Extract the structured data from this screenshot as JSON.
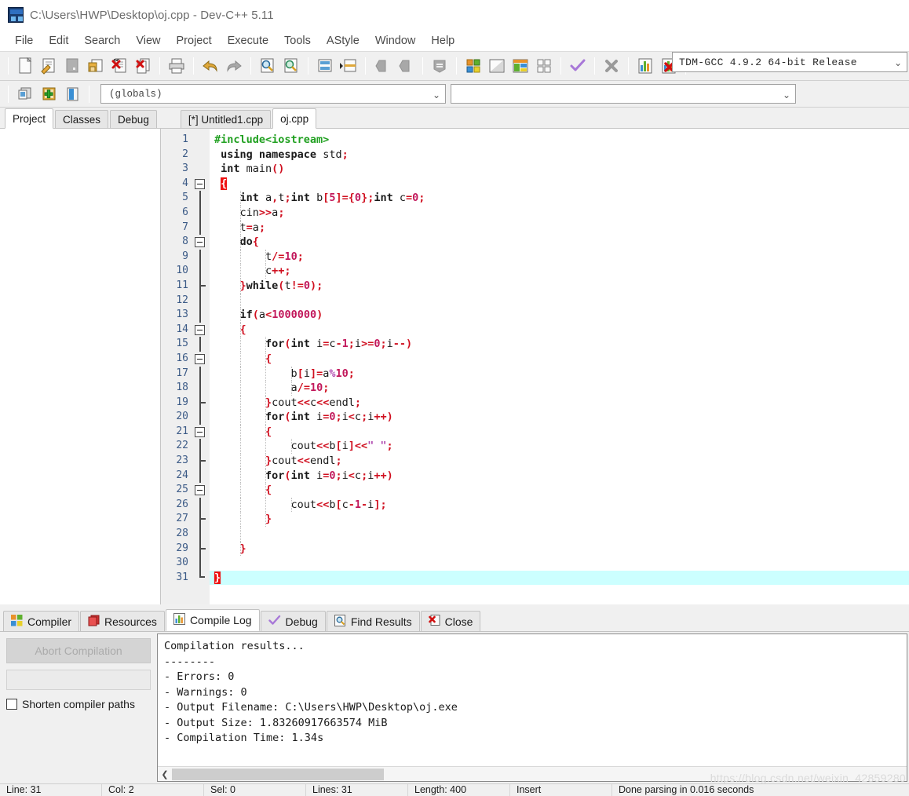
{
  "window": {
    "title": "C:\\Users\\HWP\\Desktop\\oj.cpp - Dev-C++ 5.11",
    "icon": "devcpp-icon"
  },
  "menubar": {
    "items": [
      {
        "label": "File"
      },
      {
        "label": "Edit"
      },
      {
        "label": "Search"
      },
      {
        "label": "View"
      },
      {
        "label": "Project"
      },
      {
        "label": "Execute"
      },
      {
        "label": "Tools"
      },
      {
        "label": "AStyle"
      },
      {
        "label": "Window"
      },
      {
        "label": "Help"
      }
    ]
  },
  "toolbar": {
    "compiler_set": "TDM-GCC 4.9.2 64-bit Release",
    "buttons": [
      {
        "name": "new-file-icon"
      },
      {
        "name": "open-file-icon"
      },
      {
        "name": "save-file-icon"
      },
      {
        "name": "save-all-icon"
      },
      {
        "name": "close-file-icon"
      },
      {
        "name": "close-all-icon"
      },
      {
        "name": "print-icon"
      },
      {
        "name": "undo-icon"
      },
      {
        "name": "redo-icon"
      },
      {
        "name": "find-icon"
      },
      {
        "name": "replace-icon"
      },
      {
        "name": "goto-line-icon"
      },
      {
        "name": "goto-function-icon"
      },
      {
        "name": "back-icon"
      },
      {
        "name": "forward-icon"
      },
      {
        "name": "toggle-bookmark-icon"
      },
      {
        "name": "compile-icon"
      },
      {
        "name": "run-icon"
      },
      {
        "name": "compile-and-run-icon"
      },
      {
        "name": "rebuild-all-icon"
      },
      {
        "name": "syntax-check-icon"
      },
      {
        "name": "stop-execution-icon"
      },
      {
        "name": "profile-icon"
      },
      {
        "name": "delete-profile-icon"
      }
    ],
    "row2_buttons": [
      {
        "name": "new-project-icon"
      },
      {
        "name": "add-to-project-icon"
      },
      {
        "name": "remove-from-project-icon"
      }
    ],
    "scope_combo": "(globals)",
    "member_combo": ""
  },
  "left_tabs": {
    "items": [
      {
        "label": "Project",
        "active": true
      },
      {
        "label": "Classes",
        "active": false
      },
      {
        "label": "Debug",
        "active": false
      }
    ]
  },
  "editor_tabs": {
    "items": [
      {
        "label": "[*] Untitled1.cpp",
        "active": false
      },
      {
        "label": "oj.cpp",
        "active": true
      }
    ]
  },
  "editor": {
    "highlighted_line": 31,
    "lines": [
      {
        "n": 1,
        "fold": "none",
        "indent_guides": 0,
        "tokens": [
          {
            "t": "pre",
            "v": "#include<iostream>"
          }
        ]
      },
      {
        "n": 2,
        "fold": "none",
        "indent_guides": 0,
        "tokens": [
          {
            "t": "sp",
            "v": " "
          },
          {
            "t": "kw",
            "v": "using namespace"
          },
          {
            "t": "id",
            "v": " std"
          },
          {
            "t": "op",
            "v": ";"
          }
        ]
      },
      {
        "n": 3,
        "fold": "none",
        "indent_guides": 0,
        "tokens": [
          {
            "t": "sp",
            "v": " "
          },
          {
            "t": "kw",
            "v": "int"
          },
          {
            "t": "id",
            "v": " main"
          },
          {
            "t": "op",
            "v": "()"
          }
        ]
      },
      {
        "n": 4,
        "fold": "start",
        "indent_guides": 0,
        "tokens": [
          {
            "t": "sp",
            "v": " "
          },
          {
            "t": "sel",
            "v": "{"
          }
        ]
      },
      {
        "n": 5,
        "fold": "bar",
        "indent_guides": 1,
        "tokens": [
          {
            "t": "sp",
            "v": "    "
          },
          {
            "t": "kw",
            "v": "int"
          },
          {
            "t": "id",
            "v": " a"
          },
          {
            "t": "op",
            "v": ","
          },
          {
            "t": "id",
            "v": "t"
          },
          {
            "t": "op",
            "v": ";"
          },
          {
            "t": "kw",
            "v": "int"
          },
          {
            "t": "id",
            "v": " b"
          },
          {
            "t": "op",
            "v": "["
          },
          {
            "t": "num",
            "v": "5"
          },
          {
            "t": "op",
            "v": "]={"
          },
          {
            "t": "num",
            "v": "0"
          },
          {
            "t": "op",
            "v": "};"
          },
          {
            "t": "kw",
            "v": "int"
          },
          {
            "t": "id",
            "v": " c"
          },
          {
            "t": "op",
            "v": "="
          },
          {
            "t": "num",
            "v": "0"
          },
          {
            "t": "op",
            "v": ";"
          }
        ]
      },
      {
        "n": 6,
        "fold": "bar",
        "indent_guides": 1,
        "tokens": [
          {
            "t": "sp",
            "v": "    "
          },
          {
            "t": "id",
            "v": "cin"
          },
          {
            "t": "op",
            "v": ">>"
          },
          {
            "t": "id",
            "v": "a"
          },
          {
            "t": "op",
            "v": ";"
          }
        ]
      },
      {
        "n": 7,
        "fold": "bar",
        "indent_guides": 1,
        "tokens": [
          {
            "t": "sp",
            "v": "    "
          },
          {
            "t": "id",
            "v": "t"
          },
          {
            "t": "op",
            "v": "="
          },
          {
            "t": "id",
            "v": "a"
          },
          {
            "t": "op",
            "v": ";"
          }
        ]
      },
      {
        "n": 8,
        "fold": "start",
        "indent_guides": 1,
        "tokens": [
          {
            "t": "sp",
            "v": "    "
          },
          {
            "t": "kw",
            "v": "do"
          },
          {
            "t": "op",
            "v": "{"
          }
        ]
      },
      {
        "n": 9,
        "fold": "bar",
        "indent_guides": 2,
        "tokens": [
          {
            "t": "sp",
            "v": "        "
          },
          {
            "t": "id",
            "v": "t"
          },
          {
            "t": "op",
            "v": "/="
          },
          {
            "t": "num",
            "v": "10"
          },
          {
            "t": "op",
            "v": ";"
          }
        ]
      },
      {
        "n": 10,
        "fold": "bar",
        "indent_guides": 2,
        "tokens": [
          {
            "t": "sp",
            "v": "        "
          },
          {
            "t": "id",
            "v": "c"
          },
          {
            "t": "op",
            "v": "++;"
          }
        ]
      },
      {
        "n": 11,
        "fold": "end",
        "indent_guides": 1,
        "tokens": [
          {
            "t": "sp",
            "v": "    "
          },
          {
            "t": "op",
            "v": "}"
          },
          {
            "t": "kw",
            "v": "while"
          },
          {
            "t": "op",
            "v": "("
          },
          {
            "t": "id",
            "v": "t"
          },
          {
            "t": "op",
            "v": "!="
          },
          {
            "t": "num",
            "v": "0"
          },
          {
            "t": "op",
            "v": ");"
          }
        ]
      },
      {
        "n": 12,
        "fold": "bar",
        "indent_guides": 1,
        "tokens": []
      },
      {
        "n": 13,
        "fold": "bar",
        "indent_guides": 1,
        "tokens": [
          {
            "t": "sp",
            "v": "    "
          },
          {
            "t": "kw",
            "v": "if"
          },
          {
            "t": "op",
            "v": "("
          },
          {
            "t": "id",
            "v": "a"
          },
          {
            "t": "op",
            "v": "<"
          },
          {
            "t": "num",
            "v": "1000000"
          },
          {
            "t": "op",
            "v": ")"
          }
        ]
      },
      {
        "n": 14,
        "fold": "start",
        "indent_guides": 1,
        "tokens": [
          {
            "t": "sp",
            "v": "    "
          },
          {
            "t": "op",
            "v": "{"
          }
        ]
      },
      {
        "n": 15,
        "fold": "bar",
        "indent_guides": 2,
        "tokens": [
          {
            "t": "sp",
            "v": "        "
          },
          {
            "t": "kw",
            "v": "for"
          },
          {
            "t": "op",
            "v": "("
          },
          {
            "t": "kw",
            "v": "int"
          },
          {
            "t": "id",
            "v": " i"
          },
          {
            "t": "op",
            "v": "="
          },
          {
            "t": "id",
            "v": "c"
          },
          {
            "t": "op",
            "v": "-"
          },
          {
            "t": "num",
            "v": "1"
          },
          {
            "t": "op",
            "v": ";"
          },
          {
            "t": "id",
            "v": "i"
          },
          {
            "t": "op",
            "v": ">="
          },
          {
            "t": "num",
            "v": "0"
          },
          {
            "t": "op",
            "v": ";"
          },
          {
            "t": "id",
            "v": "i"
          },
          {
            "t": "op",
            "v": "--)"
          }
        ]
      },
      {
        "n": 16,
        "fold": "start",
        "indent_guides": 2,
        "tokens": [
          {
            "t": "sp",
            "v": "        "
          },
          {
            "t": "op",
            "v": "{"
          }
        ]
      },
      {
        "n": 17,
        "fold": "bar",
        "indent_guides": 3,
        "tokens": [
          {
            "t": "sp",
            "v": "            "
          },
          {
            "t": "id",
            "v": "b"
          },
          {
            "t": "op",
            "v": "["
          },
          {
            "t": "id",
            "v": "i"
          },
          {
            "t": "op",
            "v": "]="
          },
          {
            "t": "id",
            "v": "a"
          },
          {
            "t": "str",
            "v": "%"
          },
          {
            "t": "num",
            "v": "10"
          },
          {
            "t": "op",
            "v": ";"
          }
        ]
      },
      {
        "n": 18,
        "fold": "bar",
        "indent_guides": 3,
        "tokens": [
          {
            "t": "sp",
            "v": "            "
          },
          {
            "t": "id",
            "v": "a"
          },
          {
            "t": "op",
            "v": "/="
          },
          {
            "t": "num",
            "v": "10"
          },
          {
            "t": "op",
            "v": ";"
          }
        ]
      },
      {
        "n": 19,
        "fold": "end",
        "indent_guides": 2,
        "tokens": [
          {
            "t": "sp",
            "v": "        "
          },
          {
            "t": "op",
            "v": "}"
          },
          {
            "t": "id",
            "v": "cout"
          },
          {
            "t": "op",
            "v": "<<"
          },
          {
            "t": "id",
            "v": "c"
          },
          {
            "t": "op",
            "v": "<<"
          },
          {
            "t": "id",
            "v": "endl"
          },
          {
            "t": "op",
            "v": ";"
          }
        ]
      },
      {
        "n": 20,
        "fold": "bar",
        "indent_guides": 2,
        "tokens": [
          {
            "t": "sp",
            "v": "        "
          },
          {
            "t": "kw",
            "v": "for"
          },
          {
            "t": "op",
            "v": "("
          },
          {
            "t": "kw",
            "v": "int"
          },
          {
            "t": "id",
            "v": " i"
          },
          {
            "t": "op",
            "v": "="
          },
          {
            "t": "num",
            "v": "0"
          },
          {
            "t": "op",
            "v": ";"
          },
          {
            "t": "id",
            "v": "i"
          },
          {
            "t": "op",
            "v": "<"
          },
          {
            "t": "id",
            "v": "c"
          },
          {
            "t": "op",
            "v": ";"
          },
          {
            "t": "id",
            "v": "i"
          },
          {
            "t": "op",
            "v": "++)"
          }
        ]
      },
      {
        "n": 21,
        "fold": "start",
        "indent_guides": 2,
        "tokens": [
          {
            "t": "sp",
            "v": "        "
          },
          {
            "t": "op",
            "v": "{"
          }
        ]
      },
      {
        "n": 22,
        "fold": "bar",
        "indent_guides": 3,
        "tokens": [
          {
            "t": "sp",
            "v": "            "
          },
          {
            "t": "id",
            "v": "cout"
          },
          {
            "t": "op",
            "v": "<<"
          },
          {
            "t": "id",
            "v": "b"
          },
          {
            "t": "op",
            "v": "["
          },
          {
            "t": "id",
            "v": "i"
          },
          {
            "t": "op",
            "v": "]<<"
          },
          {
            "t": "str",
            "v": "\" \""
          },
          {
            "t": "op",
            "v": ";"
          }
        ]
      },
      {
        "n": 23,
        "fold": "end",
        "indent_guides": 2,
        "tokens": [
          {
            "t": "sp",
            "v": "        "
          },
          {
            "t": "op",
            "v": "}"
          },
          {
            "t": "id",
            "v": "cout"
          },
          {
            "t": "op",
            "v": "<<"
          },
          {
            "t": "id",
            "v": "endl"
          },
          {
            "t": "op",
            "v": ";"
          }
        ]
      },
      {
        "n": 24,
        "fold": "bar",
        "indent_guides": 2,
        "tokens": [
          {
            "t": "sp",
            "v": "        "
          },
          {
            "t": "kw",
            "v": "for"
          },
          {
            "t": "op",
            "v": "("
          },
          {
            "t": "kw",
            "v": "int"
          },
          {
            "t": "id",
            "v": " i"
          },
          {
            "t": "op",
            "v": "="
          },
          {
            "t": "num",
            "v": "0"
          },
          {
            "t": "op",
            "v": ";"
          },
          {
            "t": "id",
            "v": "i"
          },
          {
            "t": "op",
            "v": "<"
          },
          {
            "t": "id",
            "v": "c"
          },
          {
            "t": "op",
            "v": ";"
          },
          {
            "t": "id",
            "v": "i"
          },
          {
            "t": "op",
            "v": "++)"
          }
        ]
      },
      {
        "n": 25,
        "fold": "start",
        "indent_guides": 2,
        "tokens": [
          {
            "t": "sp",
            "v": "        "
          },
          {
            "t": "op",
            "v": "{"
          }
        ]
      },
      {
        "n": 26,
        "fold": "bar",
        "indent_guides": 3,
        "tokens": [
          {
            "t": "sp",
            "v": "            "
          },
          {
            "t": "id",
            "v": "cout"
          },
          {
            "t": "op",
            "v": "<<"
          },
          {
            "t": "id",
            "v": "b"
          },
          {
            "t": "op",
            "v": "["
          },
          {
            "t": "id",
            "v": "c"
          },
          {
            "t": "op",
            "v": "-"
          },
          {
            "t": "num",
            "v": "1"
          },
          {
            "t": "op",
            "v": "-"
          },
          {
            "t": "id",
            "v": "i"
          },
          {
            "t": "op",
            "v": "];"
          }
        ]
      },
      {
        "n": 27,
        "fold": "end",
        "indent_guides": 2,
        "tokens": [
          {
            "t": "sp",
            "v": "        "
          },
          {
            "t": "op",
            "v": "}"
          }
        ]
      },
      {
        "n": 28,
        "fold": "bar",
        "indent_guides": 1,
        "tokens": []
      },
      {
        "n": 29,
        "fold": "end",
        "indent_guides": 1,
        "tokens": [
          {
            "t": "sp",
            "v": "    "
          },
          {
            "t": "op",
            "v": "}"
          }
        ]
      },
      {
        "n": 30,
        "fold": "bar",
        "indent_guides": 0,
        "tokens": []
      },
      {
        "n": 31,
        "fold": "close",
        "indent_guides": 0,
        "tokens": [
          {
            "t": "sel",
            "v": "}"
          }
        ]
      }
    ]
  },
  "bottom_tabs": {
    "items": [
      {
        "label": "Compiler",
        "icon": "compiler-icon",
        "active": false
      },
      {
        "label": "Resources",
        "icon": "resources-icon",
        "active": false
      },
      {
        "label": "Compile Log",
        "icon": "compile-log-icon",
        "active": true
      },
      {
        "label": "Debug",
        "icon": "debug-check-icon",
        "active": false
      },
      {
        "label": "Find Results",
        "icon": "find-results-icon",
        "active": false
      },
      {
        "label": "Close",
        "icon": "close-panel-icon",
        "active": false
      }
    ]
  },
  "compile_panel": {
    "abort_label": "Abort Compilation",
    "progress_value": "",
    "shorten_paths_label": "Shorten compiler paths",
    "shorten_paths_checked": false,
    "log_lines": [
      "Compilation results...",
      "--------",
      "- Errors: 0",
      "- Warnings: 0",
      "- Output Filename: C:\\Users\\HWP\\Desktop\\oj.exe",
      "- Output Size: 1.83260917663574 MiB",
      "- Compilation Time: 1.34s"
    ]
  },
  "statusbar": {
    "cells": [
      "Line: 31",
      "Col: 2",
      "Sel: 0",
      "Lines: 31",
      "Length: 400",
      "Insert",
      "Done parsing in 0.016 seconds"
    ]
  },
  "watermark": "https://blog.csdn.net/weixin_42859280",
  "colors": {
    "accent_red": "#ee1111",
    "highlight_line": "#ccffff",
    "preprocessor_green": "#20a020",
    "number_pink": "#c2185b",
    "string_purple": "#b04ab0",
    "gutter_bg": "#efefef",
    "gutter_text": "#3b5a86",
    "chrome_bg": "#f0f0f0"
  }
}
